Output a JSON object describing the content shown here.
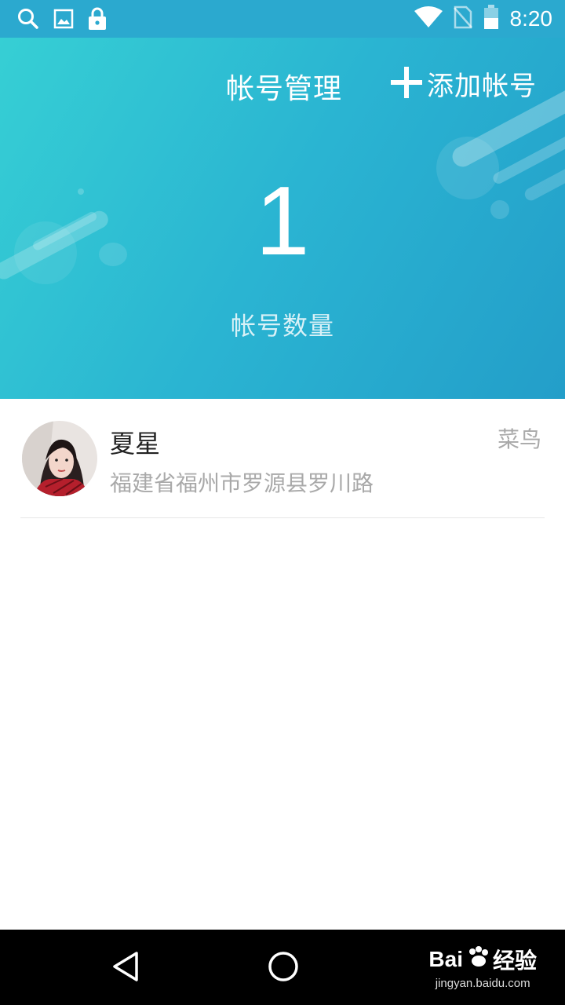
{
  "status_bar": {
    "time": "8:20",
    "left_icons": [
      "search-icon",
      "image-icon",
      "lock-icon"
    ],
    "right_icons": [
      "wifi-icon",
      "no-sim-icon",
      "battery-icon"
    ]
  },
  "header": {
    "title": "帐号管理",
    "add_label": "添加帐号",
    "count": "1",
    "count_label": "帐号数量",
    "gradient_colors": [
      "#36cfd4",
      "#239ec9"
    ]
  },
  "accounts": [
    {
      "name": "夏星",
      "level": "菜鸟",
      "address": "福建省福州市罗源县罗川路"
    }
  ],
  "nav_bar": {
    "buttons": [
      "back-icon",
      "home-icon"
    ]
  },
  "watermark": {
    "brand": "Bai",
    "brand_suffix": "经验",
    "url": "jingyan.baidu.com"
  }
}
